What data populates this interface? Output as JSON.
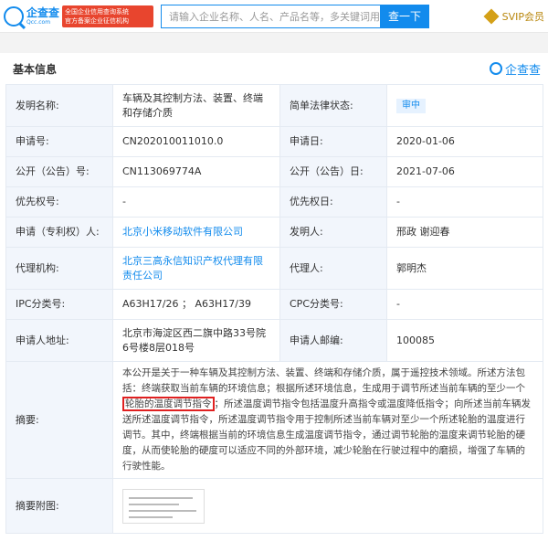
{
  "header": {
    "logo_cn": "企查查",
    "logo_en": "Qcc.com",
    "badge_line1": "全国企业信用查询系统",
    "badge_line2": "官方备案企业征信机构",
    "search_placeholder": "请输入企业名称、人名、产品名等，多关键词用空格",
    "search_button": "查一下",
    "svip_label": "SVIP会员"
  },
  "section": {
    "title": "基本信息",
    "watermark": "企查查"
  },
  "rows": {
    "invention_name_label": "发明名称:",
    "invention_name_value": "车辆及其控制方法、装置、终端和存储介质",
    "legal_status_label": "简单法律状态:",
    "legal_status_value": "审中",
    "app_no_label": "申请号:",
    "app_no_value": "CN202010011010.0",
    "app_date_label": "申请日:",
    "app_date_value": "2020-01-06",
    "pub_no_label": "公开（公告）号:",
    "pub_no_value": "CN113069774A",
    "pub_date_label": "公开（公告）日:",
    "pub_date_value": "2021-07-06",
    "priority_no_label": "优先权号:",
    "priority_no_value": "-",
    "priority_date_label": "优先权日:",
    "priority_date_value": "-",
    "applicant_label": "申请（专利权）人:",
    "applicant_value": "北京小米移动软件有限公司",
    "inventor_label": "发明人:",
    "inventor_value": "邢政 谢迎春",
    "agency_label": "代理机构:",
    "agency_value": "北京三高永信知识产权代理有限责任公司",
    "agent_label": "代理人:",
    "agent_value": "郭明杰",
    "ipc_label": "IPC分类号:",
    "ipc_value": "A63H17/26 ； A63H17/39",
    "cpc_label": "CPC分类号:",
    "cpc_value": "-",
    "address_label": "申请人地址:",
    "address_value": "北京市海淀区西二旗中路33号院6号楼8层018号",
    "postcode_label": "申请人邮编:",
    "postcode_value": "100085",
    "abstract_label": "摘要:",
    "abstract_part1": "本公开是关于一种车辆及其控制方法、装置、终端和存储介质，属于遥控技术领域。所述方法包括：终端获取当前车辆的环境信息；根据所述环境信息，生成用于调节所述当前车辆的至少一个",
    "abstract_highlight": "轮胎的温度调节指令",
    "abstract_part2": "；所述温度调节指令包括温度升高指令或温度降低指令；向所述当前车辆发送所述温度调节指令，所述温度调节指令用于控制所述当前车辆对至少一个所述轮胎的温度进行调节。其中，终端根据当前的环境信息生成温度调节指令，通过调节轮胎的温度来调节轮胎的硬度，从而使轮胎的硬度可以适应不同的外部环境，减少轮胎在行驶过程中的磨损，增强了车辆的行驶性能。",
    "figure_label": "摘要附图:"
  }
}
